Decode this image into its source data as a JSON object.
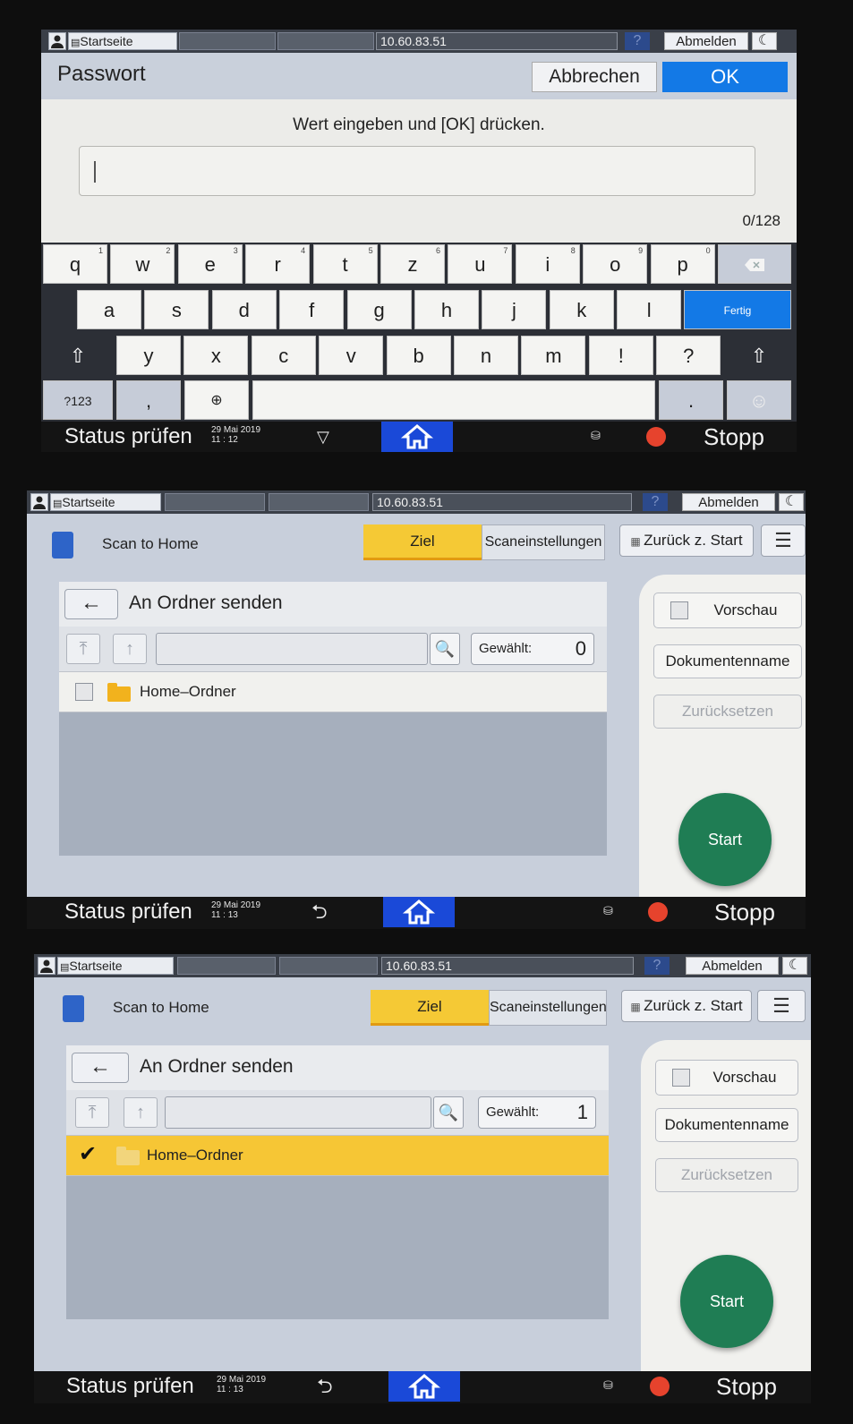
{
  "common": {
    "home_tab": "Startseite",
    "ip": "10.60.83.51",
    "help": "?",
    "logout": "Abmelden",
    "moon": "☾",
    "status_label": "Status prüfen",
    "stop_label": "Stopp"
  },
  "panel1": {
    "title": "Passwort",
    "cancel": "Abbrechen",
    "ok": "OK",
    "instruction": "Wert eingeben und [OK] drücken.",
    "input_value": "",
    "counter": "0/128",
    "date": "29 Mai 2019",
    "time": "11 : 12",
    "keys_row1": [
      {
        "k": "q",
        "n": "1"
      },
      {
        "k": "w",
        "n": "2"
      },
      {
        "k": "e",
        "n": "3"
      },
      {
        "k": "r",
        "n": "4"
      },
      {
        "k": "t",
        "n": "5"
      },
      {
        "k": "z",
        "n": "6"
      },
      {
        "k": "u",
        "n": "7"
      },
      {
        "k": "i",
        "n": "8"
      },
      {
        "k": "o",
        "n": "9"
      },
      {
        "k": "p",
        "n": "0"
      }
    ],
    "keys_row2": [
      "a",
      "s",
      "d",
      "f",
      "g",
      "h",
      "j",
      "k",
      "l"
    ],
    "done_key": "Fertig",
    "keys_row3": [
      "y",
      "x",
      "c",
      "v",
      "b",
      "n",
      "m",
      "!",
      "?"
    ],
    "num_key": "?123",
    "comma_key": ",",
    "dot_key": "."
  },
  "scan": {
    "app_title": "Scan to Home",
    "tab_ziel": "Ziel",
    "tab_settings": "Scaneinstellungen",
    "back_to_start": "Zurück z. Start",
    "folder_header": "An Ordner senden",
    "selected_label": "Gewählt:",
    "folder_name": "Home–Ordner",
    "preview": "Vorschau",
    "doc_name": "Dokumentenname",
    "reset": "Zurücksetzen",
    "start": "Start"
  },
  "panel2": {
    "selected_count": "0",
    "date": "29 Mai 2019",
    "time": "11 : 13"
  },
  "panel3": {
    "selected_count": "1",
    "date": "29 Mai 2019",
    "time": "11 : 13"
  }
}
